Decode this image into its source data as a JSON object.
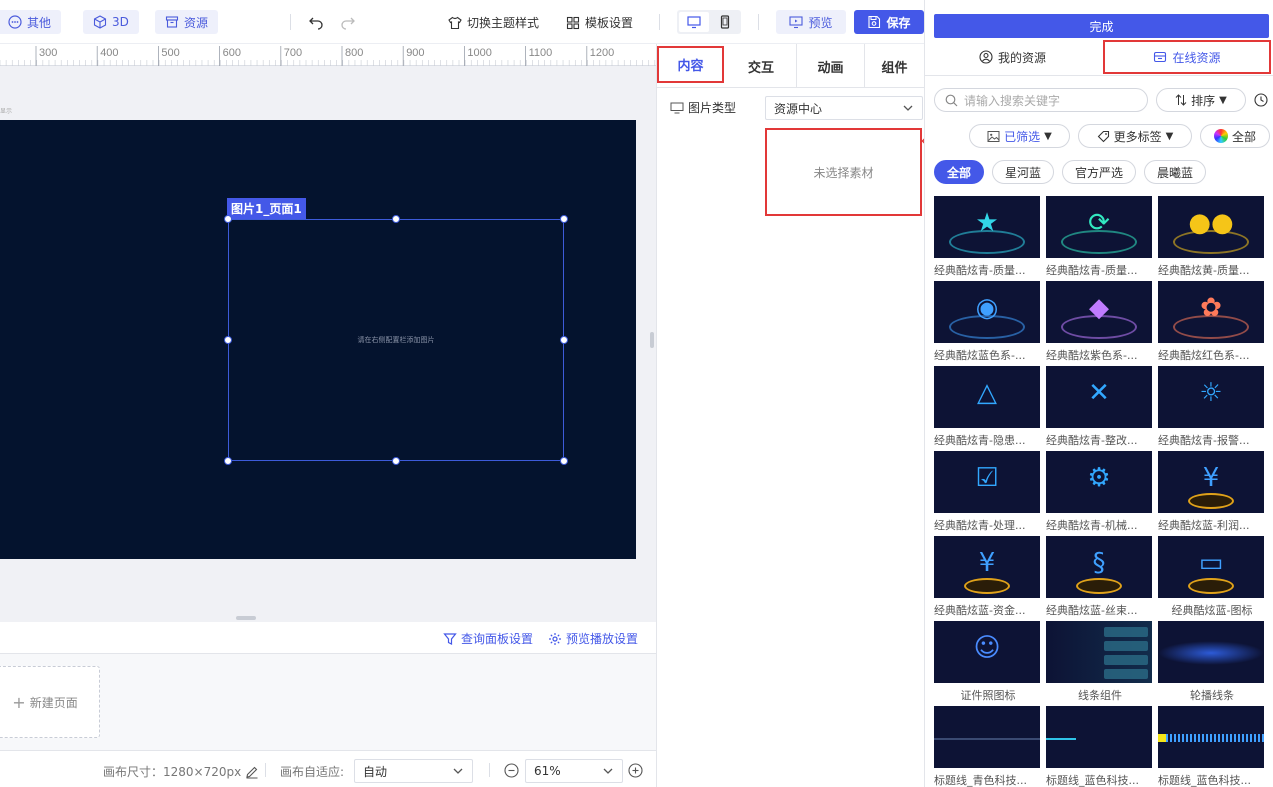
{
  "toolbar": {
    "other": "其他",
    "three_d": "3D",
    "resources": "资源",
    "switch_theme": "切换主题样式",
    "template_settings": "模板设置",
    "preview": "预览",
    "save": "保存"
  },
  "ruler": {
    "ticks": [
      "300",
      "400",
      "500",
      "600",
      "700",
      "800",
      "900",
      "1000",
      "1100",
      "1200"
    ]
  },
  "canvas": {
    "corner_hint": "显示",
    "selection_label": "图片1_页面1",
    "selection_hint": "请在右侧配置栏添加图片"
  },
  "page_tools": {
    "query_panel": "查询面板设置",
    "preview_play": "预览播放设置",
    "new_page": "新建页面"
  },
  "status": {
    "canvas_size_label": "画布尺寸：",
    "canvas_size_value": "1280×720px",
    "adapt_label": "画布自适应:",
    "adapt_value": "自动",
    "zoom_value": "61%"
  },
  "mid_panel": {
    "tabs": [
      "内容",
      "交互",
      "动画",
      "组件"
    ],
    "image_type_label": "图片类型",
    "image_type_value": "资源中心",
    "empty_material": "未选择素材"
  },
  "right_panel": {
    "done": "完成",
    "tab_my": "我的资源",
    "tab_online": "在线资源",
    "search_placeholder": "请输入搜索关键字",
    "sort": "排序",
    "filtered": "已筛选",
    "more_tags": "更多标签",
    "all_colors": "全部",
    "categories": [
      "全部",
      "星河蓝",
      "官方严选",
      "晨曦蓝"
    ],
    "assets": [
      "经典酷炫青-质量...",
      "经典酷炫青-质量...",
      "经典酷炫黄-质量...",
      "经典酷炫蓝色系-...",
      "经典酷炫紫色系-...",
      "经典酷炫红色系-...",
      "经典酷炫青-隐患...",
      "经典酷炫青-整改...",
      "经典酷炫青-报警...",
      "经典酷炫青-处理...",
      "经典酷炫青-机械...",
      "经典酷炫蓝-利润...",
      "经典酷炫蓝-资金...",
      "经典酷炫蓝-丝束...",
      "经典酷炫蓝-图标",
      "证件照图标",
      "线条组件",
      "轮播线条",
      "标题线_青色科技...",
      "标题线_蓝色科技...",
      "标题线_蓝色科技..."
    ]
  },
  "colors": {
    "accent": "#4458e8",
    "stage": "#04132e",
    "highlight_red": "#e23838"
  }
}
